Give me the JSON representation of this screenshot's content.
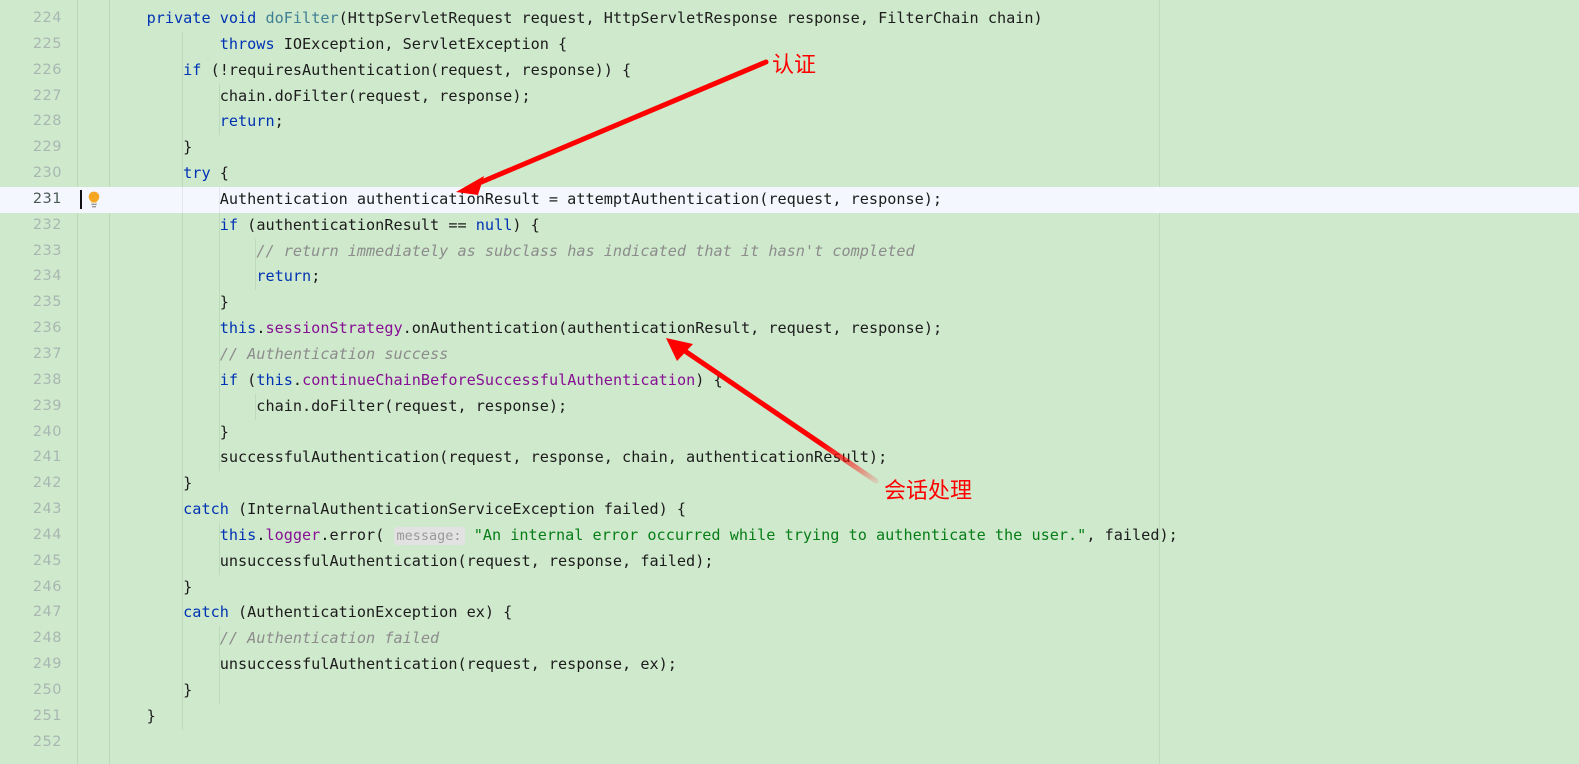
{
  "editor": {
    "theme_background": "#cfe9cc",
    "current_line_background": "#f4f7fd",
    "current_line_number": 231,
    "gutter_icon": "lightbulb-icon",
    "right_margin_column_x": 1159
  },
  "colors": {
    "keyword": "#0033b3",
    "method": "#3f7f93",
    "field": "#871094",
    "string": "#067d17",
    "comment": "#8c8c8c",
    "plain_text": "#1c1c1c",
    "annotation_red": "#ff0000",
    "line_number": "#a9b7b2",
    "line_number_active": "#4b5a55"
  },
  "annotations": [
    {
      "id": "anno-1",
      "label": "认证",
      "points_to_line": 231
    },
    {
      "id": "anno-2",
      "label": "会话处理",
      "points_to_line": 236
    }
  ],
  "code_lines": [
    {
      "no": 224,
      "indent_guides": [],
      "tokens": [
        {
          "t": "    ",
          "c": "plain"
        },
        {
          "t": "private",
          "c": "kw"
        },
        {
          "t": " ",
          "c": "plain"
        },
        {
          "t": "void",
          "c": "kw"
        },
        {
          "t": " ",
          "c": "plain"
        },
        {
          "t": "doFilter",
          "c": "meth"
        },
        {
          "t": "(HttpServletRequest request, HttpServletResponse response, FilterChain chain)",
          "c": "plain"
        }
      ]
    },
    {
      "no": 225,
      "indent_guides": [
        0
      ],
      "tokens": [
        {
          "t": "            ",
          "c": "plain"
        },
        {
          "t": "throws",
          "c": "kw"
        },
        {
          "t": " IOException, ServletException {",
          "c": "plain"
        }
      ]
    },
    {
      "no": 226,
      "indent_guides": [
        0
      ],
      "tokens": [
        {
          "t": "        ",
          "c": "plain"
        },
        {
          "t": "if",
          "c": "kw"
        },
        {
          "t": " (!requiresAuthentication(request, response)) {",
          "c": "plain"
        }
      ]
    },
    {
      "no": 227,
      "indent_guides": [
        0,
        1
      ],
      "tokens": [
        {
          "t": "            chain.doFilter(request, response);",
          "c": "plain"
        }
      ]
    },
    {
      "no": 228,
      "indent_guides": [
        0,
        1
      ],
      "tokens": [
        {
          "t": "            ",
          "c": "plain"
        },
        {
          "t": "return",
          "c": "kw"
        },
        {
          "t": ";",
          "c": "plain"
        }
      ]
    },
    {
      "no": 229,
      "indent_guides": [
        0
      ],
      "tokens": [
        {
          "t": "        }",
          "c": "plain"
        }
      ]
    },
    {
      "no": 230,
      "indent_guides": [
        0
      ],
      "tokens": [
        {
          "t": "        ",
          "c": "plain"
        },
        {
          "t": "try",
          "c": "kw"
        },
        {
          "t": " {",
          "c": "plain"
        }
      ]
    },
    {
      "no": 231,
      "current": true,
      "indent_guides": [
        0,
        1
      ],
      "tokens": [
        {
          "t": "            Authentication authenticationResult = attemptAuthentication(request, response);",
          "c": "plain"
        }
      ]
    },
    {
      "no": 232,
      "indent_guides": [
        0,
        1
      ],
      "tokens": [
        {
          "t": "            ",
          "c": "plain"
        },
        {
          "t": "if",
          "c": "kw"
        },
        {
          "t": " (authenticationResult == ",
          "c": "plain"
        },
        {
          "t": "null",
          "c": "kw"
        },
        {
          "t": ") {",
          "c": "plain"
        }
      ]
    },
    {
      "no": 233,
      "indent_guides": [
        0,
        1,
        2
      ],
      "tokens": [
        {
          "t": "                ",
          "c": "plain"
        },
        {
          "t": "// return immediately as subclass has indicated that it hasn't completed",
          "c": "cmt"
        }
      ]
    },
    {
      "no": 234,
      "indent_guides": [
        0,
        1,
        2
      ],
      "tokens": [
        {
          "t": "                ",
          "c": "plain"
        },
        {
          "t": "return",
          "c": "kw"
        },
        {
          "t": ";",
          "c": "plain"
        }
      ]
    },
    {
      "no": 235,
      "indent_guides": [
        0,
        1
      ],
      "tokens": [
        {
          "t": "            }",
          "c": "plain"
        }
      ]
    },
    {
      "no": 236,
      "indent_guides": [
        0,
        1
      ],
      "tokens": [
        {
          "t": "            ",
          "c": "plain"
        },
        {
          "t": "this",
          "c": "kw"
        },
        {
          "t": ".",
          "c": "plain"
        },
        {
          "t": "sessionStrategy",
          "c": "fld"
        },
        {
          "t": ".onAuthentication(authenticationResult, request, response);",
          "c": "plain"
        }
      ]
    },
    {
      "no": 237,
      "indent_guides": [
        0,
        1
      ],
      "tokens": [
        {
          "t": "            ",
          "c": "plain"
        },
        {
          "t": "// Authentication success",
          "c": "cmt"
        }
      ]
    },
    {
      "no": 238,
      "indent_guides": [
        0,
        1
      ],
      "tokens": [
        {
          "t": "            ",
          "c": "plain"
        },
        {
          "t": "if",
          "c": "kw"
        },
        {
          "t": " (",
          "c": "plain"
        },
        {
          "t": "this",
          "c": "kw"
        },
        {
          "t": ".",
          "c": "plain"
        },
        {
          "t": "continueChainBeforeSuccessfulAuthentication",
          "c": "fld"
        },
        {
          "t": ") {",
          "c": "plain"
        }
      ]
    },
    {
      "no": 239,
      "indent_guides": [
        0,
        1,
        2
      ],
      "tokens": [
        {
          "t": "                chain.doFilter(request, response);",
          "c": "plain"
        }
      ]
    },
    {
      "no": 240,
      "indent_guides": [
        0,
        1
      ],
      "tokens": [
        {
          "t": "            }",
          "c": "plain"
        }
      ]
    },
    {
      "no": 241,
      "indent_guides": [
        0,
        1
      ],
      "tokens": [
        {
          "t": "            successfulAuthentication(request, response, chain, authenticationResult);",
          "c": "plain"
        }
      ]
    },
    {
      "no": 242,
      "indent_guides": [
        0
      ],
      "tokens": [
        {
          "t": "        }",
          "c": "plain"
        }
      ]
    },
    {
      "no": 243,
      "indent_guides": [
        0
      ],
      "tokens": [
        {
          "t": "        ",
          "c": "plain"
        },
        {
          "t": "catch",
          "c": "kw"
        },
        {
          "t": " (InternalAuthenticationServiceException failed) {",
          "c": "plain"
        }
      ]
    },
    {
      "no": 244,
      "indent_guides": [
        0,
        1
      ],
      "tokens": [
        {
          "t": "            ",
          "c": "plain"
        },
        {
          "t": "this",
          "c": "kw"
        },
        {
          "t": ".",
          "c": "plain"
        },
        {
          "t": "logger",
          "c": "fld"
        },
        {
          "t": ".error( ",
          "c": "plain"
        },
        {
          "t": "message:",
          "c": "hint"
        },
        {
          "t": " ",
          "c": "plain"
        },
        {
          "t": "\"An internal error occurred while trying to authenticate the user.\"",
          "c": "str"
        },
        {
          "t": ", failed);",
          "c": "plain"
        }
      ]
    },
    {
      "no": 245,
      "indent_guides": [
        0,
        1
      ],
      "tokens": [
        {
          "t": "            unsuccessfulAuthentication(request, response, failed);",
          "c": "plain"
        }
      ]
    },
    {
      "no": 246,
      "indent_guides": [
        0
      ],
      "tokens": [
        {
          "t": "        }",
          "c": "plain"
        }
      ]
    },
    {
      "no": 247,
      "indent_guides": [
        0
      ],
      "tokens": [
        {
          "t": "        ",
          "c": "plain"
        },
        {
          "t": "catch",
          "c": "kw"
        },
        {
          "t": " (AuthenticationException ex) {",
          "c": "plain"
        }
      ]
    },
    {
      "no": 248,
      "indent_guides": [
        0,
        1
      ],
      "tokens": [
        {
          "t": "            ",
          "c": "plain"
        },
        {
          "t": "// Authentication failed",
          "c": "cmt"
        }
      ]
    },
    {
      "no": 249,
      "indent_guides": [
        0,
        1
      ],
      "tokens": [
        {
          "t": "            unsuccessfulAuthentication(request, response, ex);",
          "c": "plain"
        }
      ]
    },
    {
      "no": 250,
      "indent_guides": [
        0,
        1
      ],
      "tokens": [
        {
          "t": "        }",
          "c": "plain"
        }
      ]
    },
    {
      "no": 251,
      "indent_guides": [
        0
      ],
      "tokens": [
        {
          "t": "    }",
          "c": "plain"
        }
      ]
    },
    {
      "no": 252,
      "indent_guides": [],
      "tokens": []
    }
  ]
}
